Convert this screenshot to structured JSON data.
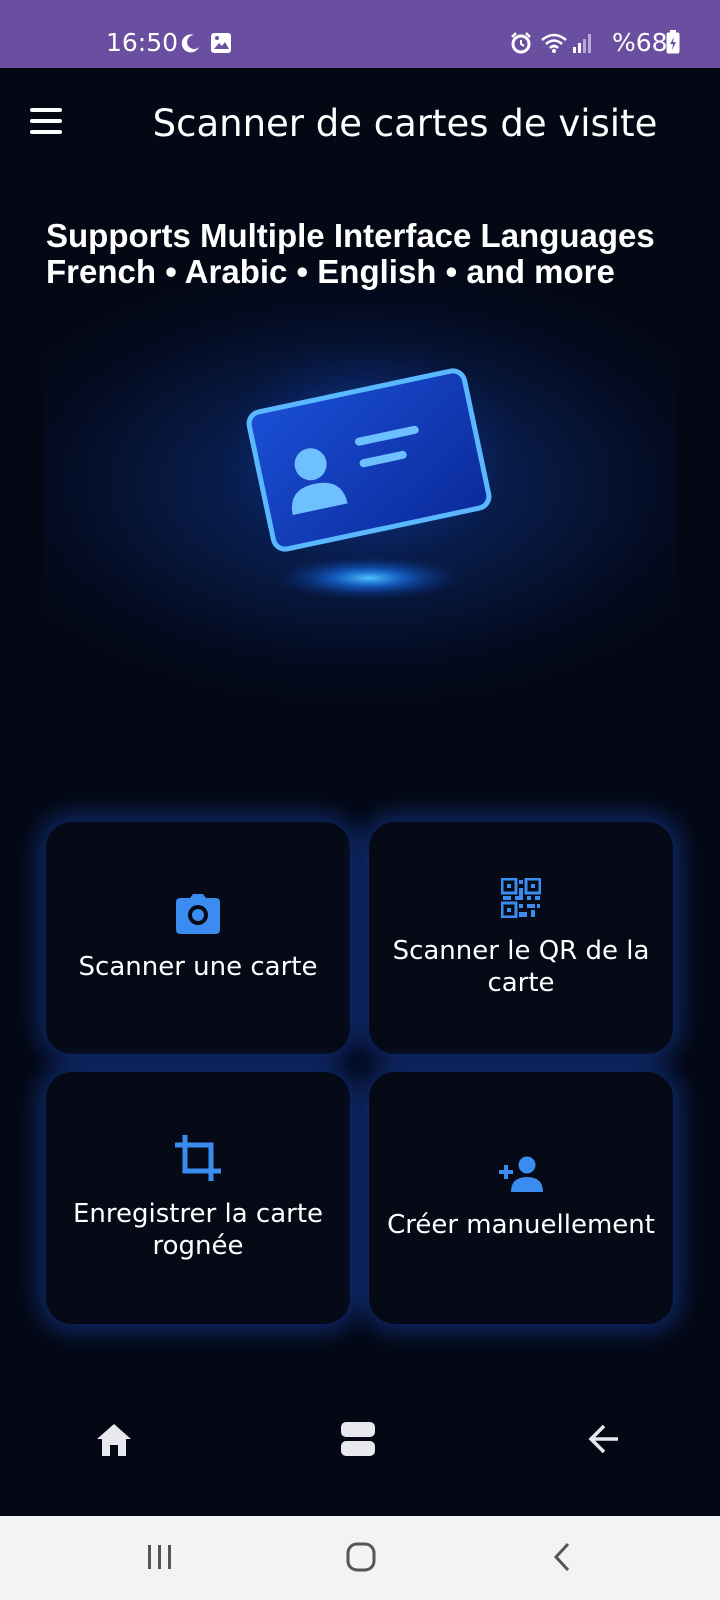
{
  "status_bar": {
    "time": "16:50",
    "battery": "%68",
    "icons": [
      "moon-icon",
      "image-icon",
      "alarm-icon",
      "wifi-icon",
      "signal-icon",
      "battery-icon"
    ]
  },
  "app_bar": {
    "title": "Scanner de cartes de visite"
  },
  "banner": {
    "line1": "Supports Multiple Interface Languages",
    "line2": "French • Arabic • English • and more"
  },
  "actions": [
    {
      "label": "Scanner une carte",
      "icon": "camera-icon"
    },
    {
      "label": "Scanner le QR de la carte",
      "icon": "qr-code-icon"
    },
    {
      "label": "Enregistrer la carte rognée",
      "icon": "crop-icon"
    },
    {
      "label": "Créer manuellement",
      "icon": "add-person-icon"
    }
  ],
  "colors": {
    "status_bar": "#6a4fa0",
    "background": "#040814",
    "accent": "#3b8cf0",
    "tile_glow": "#1e5ae6"
  }
}
